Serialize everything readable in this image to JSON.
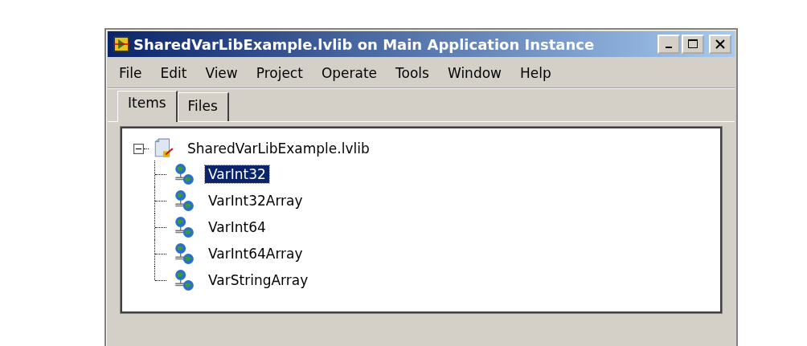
{
  "window": {
    "title": "SharedVarLibExample.lvlib on Main Application Instance"
  },
  "menu": [
    "File",
    "Edit",
    "View",
    "Project",
    "Operate",
    "Tools",
    "Window",
    "Help"
  ],
  "tabs": [
    {
      "label": "Items",
      "selected": true
    },
    {
      "label": "Files",
      "selected": false
    }
  ],
  "tree": {
    "label": "SharedVarLibExample.lvlib",
    "expanded": true,
    "children": [
      {
        "label": "VarInt32",
        "selected": true
      },
      {
        "label": "VarInt32Array",
        "selected": false
      },
      {
        "label": "VarInt64",
        "selected": false
      },
      {
        "label": "VarInt64Array",
        "selected": false
      },
      {
        "label": "VarStringArray",
        "selected": false
      }
    ]
  }
}
